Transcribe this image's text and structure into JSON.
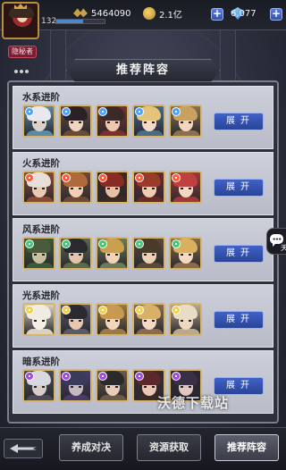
{
  "player": {
    "level": "132",
    "badge": "隐秘者",
    "exp_fraction": 0.55
  },
  "resources": {
    "wings": "5464090",
    "gold": "2.1亿",
    "gems": "6,077",
    "plus": "+"
  },
  "panel": {
    "title": "推荐阵容",
    "expand_label": "展开",
    "sections": [
      {
        "title": "水系进阶",
        "element_color": "#4aa3ff",
        "heroes": [
          {
            "hair": "#e8e8ee",
            "skin": "#d9d3c8",
            "body": "#5a8aa8"
          },
          {
            "hair": "#2a2226",
            "skin": "#f1d4c0",
            "body": "#6a4a3a"
          },
          {
            "hair": "#3a2a28",
            "skin": "#efc8b0",
            "body": "#7a3030"
          },
          {
            "hair": "#e3c47a",
            "skin": "#f6dcc6",
            "body": "#4a6a8a"
          },
          {
            "hair": "#c8a060",
            "skin": "#f3d6c0",
            "body": "#8a7050"
          }
        ]
      },
      {
        "title": "火系进阶",
        "element_color": "#ff5a3a",
        "heroes": [
          {
            "hair": "#e8e0d8",
            "skin": "#e9cbb4",
            "body": "#8a4a3a"
          },
          {
            "hair": "#b06a3a",
            "skin": "#f1d0b6",
            "body": "#704838"
          },
          {
            "hair": "#8a2a22",
            "skin": "#e8c0a4",
            "body": "#3a2a22"
          },
          {
            "hair": "#9a3a2a",
            "skin": "#f0ccb0",
            "body": "#6a2a2a"
          },
          {
            "hair": "#c04040",
            "skin": "#f4d8c4",
            "body": "#a03838"
          }
        ]
      },
      {
        "title": "风系进阶",
        "element_color": "#45c878",
        "heroes": [
          {
            "hair": "#4a5a3a",
            "skin": "#c8c0a0",
            "body": "#3a5a3a"
          },
          {
            "hair": "#2a2a2e",
            "skin": "#e0c4ac",
            "body": "#5a6a4a"
          },
          {
            "hair": "#c8a050",
            "skin": "#f0d4b8",
            "body": "#6a7a5a"
          },
          {
            "hair": "#4a3a2a",
            "skin": "#ecd0b8",
            "body": "#5a4a3a"
          },
          {
            "hair": "#d8b060",
            "skin": "#f4d8c2",
            "body": "#8a6a4a"
          }
        ]
      },
      {
        "title": "光系进阶",
        "element_color": "#f2d24a",
        "heroes": [
          {
            "hair": "#f0ece4",
            "skin": "#f4f0e8",
            "body": "#d8d2c4"
          },
          {
            "hair": "#2a2a30",
            "skin": "#e6c8b0",
            "body": "#5a5a6a"
          },
          {
            "hair": "#c89a50",
            "skin": "#f2d6bc",
            "body": "#9a7a4a"
          },
          {
            "hair": "#d8b068",
            "skin": "#f4dac4",
            "body": "#8a6a50"
          },
          {
            "hair": "#e8dcc4",
            "skin": "#efd8c0",
            "body": "#b8a890"
          }
        ]
      },
      {
        "title": "暗系进阶",
        "element_color": "#a04ae0",
        "heroes": [
          {
            "hair": "#d8d8e0",
            "skin": "#d8ccc8",
            "body": "#4a4a5a"
          },
          {
            "hair": "#3a3a5a",
            "skin": "#c8b8c0",
            "body": "#4a3a6a"
          },
          {
            "hair": "#2a2a2a",
            "skin": "#e8ccb8",
            "body": "#6a5a4a"
          },
          {
            "hair": "#5a2a2a",
            "skin": "#ecc8b4",
            "body": "#3a2a2a"
          },
          {
            "hair": "#3a3046",
            "skin": "#e0c8c0",
            "body": "#2a2436"
          }
        ]
      }
    ]
  },
  "chat": {
    "label": "天"
  },
  "watermark": "沃德下载站",
  "bottom": {
    "tab1": "养成对决",
    "tab2": "资源获取",
    "tab3": "推荐阵容"
  }
}
